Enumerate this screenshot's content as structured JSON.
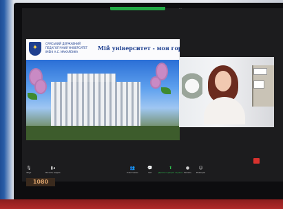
{
  "meeting": {
    "indicator_text": "...",
    "shared_slide": {
      "university_name": "СУМСЬКИЙ ДЕРЖАВНИЙ ПЕДАГОГІЧНИЙ УНІВЕРСИТЕТ ІМЕНІ А.С. МАКАРЕНКА",
      "motto": "Мій університет - моя гордість!"
    },
    "participant": {
      "name_label": "..."
    },
    "toolbar": {
      "items": [
        {
          "label": "Звук",
          "icon": "microphone-icon"
        },
        {
          "label": "Начать видео",
          "icon": "video-icon"
        },
        {
          "label": "Участники",
          "icon": "participants-icon"
        },
        {
          "label": "Чат",
          "icon": "chat-icon"
        },
        {
          "label": "Демонстрация экрана",
          "icon": "share-screen-icon"
        },
        {
          "label": "Запись",
          "icon": "record-icon"
        },
        {
          "label": "Реакции",
          "icon": "reactions-icon"
        }
      ]
    },
    "colors": {
      "share_green": "#2fbf4f",
      "end_red": "#d8322e"
    }
  },
  "monitor": {
    "brand_label": "1080"
  }
}
